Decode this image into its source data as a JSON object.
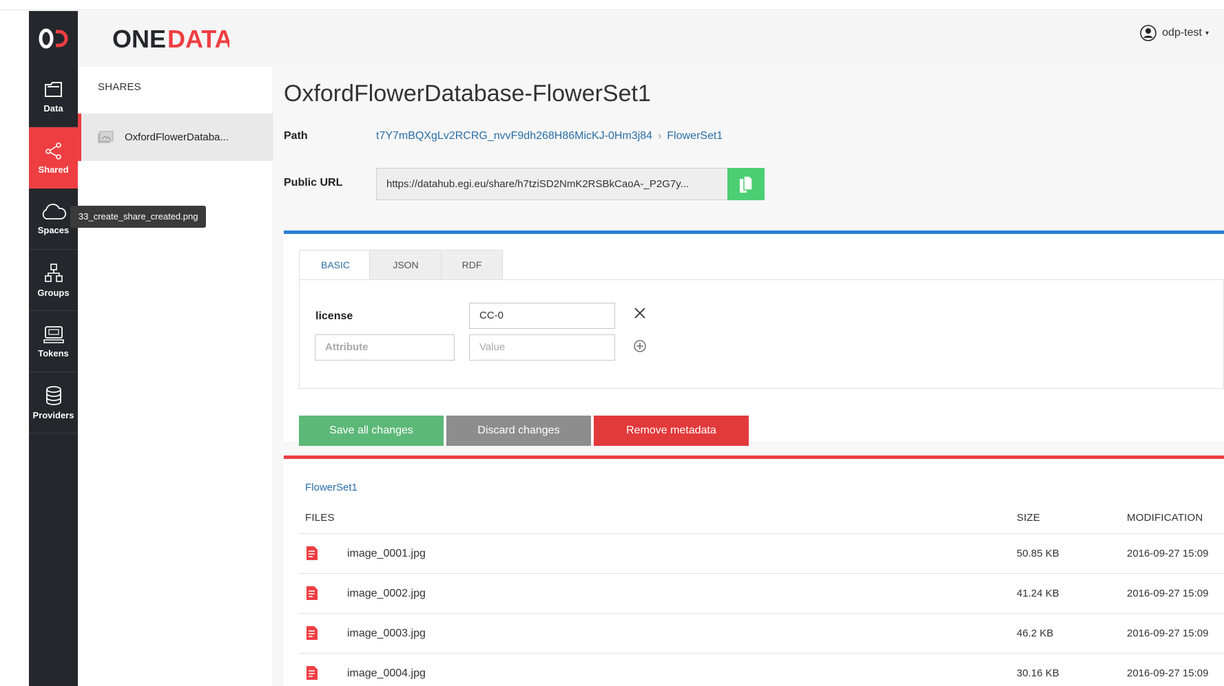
{
  "brand": {
    "logo_mark": "OD",
    "logo_text_left": "ONE",
    "logo_text_right": "DATA",
    "accent_color": "#ef3e42"
  },
  "user": {
    "name": "odp-test",
    "icon": "user-circle-icon"
  },
  "sidebar": {
    "items": [
      {
        "label": "Data",
        "icon": "folder-icon",
        "active": false
      },
      {
        "label": "Shared",
        "icon": "share-icon",
        "active": true
      },
      {
        "label": "Spaces",
        "icon": "cloud-icon",
        "active": false
      },
      {
        "label": "Groups",
        "icon": "groups-icon",
        "active": false
      },
      {
        "label": "Tokens",
        "icon": "token-icon",
        "active": false
      },
      {
        "label": "Providers",
        "icon": "database-icon",
        "active": false
      }
    ]
  },
  "tooltip": {
    "text": "33_create_share_created.png"
  },
  "shares": {
    "title": "SHARES",
    "items": [
      {
        "label": "OxfordFlowerDataba...",
        "icon": "share-image-icon"
      }
    ]
  },
  "share": {
    "title": "OxfordFlowerDatabase-FlowerSet1",
    "path_label": "Path",
    "path_root": "t7Y7mBQXgLv2RCRG_nvvF9dh268H86MicKJ-0Hm3j84",
    "path_leaf": "FlowerSet1",
    "public_url_label": "Public URL",
    "public_url": "https://datahub.egi.eu/share/h7tziSD2NmK2RSBkCaoA-_P2G7y..."
  },
  "metadata": {
    "tabs": [
      {
        "label": "BASIC",
        "active": true
      },
      {
        "label": "JSON",
        "active": false
      },
      {
        "label": "RDF",
        "active": false
      }
    ],
    "entries": [
      {
        "key": "license",
        "value": "CC-0"
      }
    ],
    "new_attribute_placeholder": "Attribute",
    "new_value_placeholder": "Value",
    "buttons": {
      "save": "Save all changes",
      "discard": "Discard changes",
      "remove": "Remove metadata"
    }
  },
  "files": {
    "breadcrumb": "FlowerSet1",
    "columns": {
      "name": "FILES",
      "size": "SIZE",
      "modification": "MODIFICATION"
    },
    "rows": [
      {
        "name": "image_0001.jpg",
        "size": "50.85 KB",
        "modified": "2016-09-27 15:09"
      },
      {
        "name": "image_0002.jpg",
        "size": "41.24 KB",
        "modified": "2016-09-27 15:09"
      },
      {
        "name": "image_0003.jpg",
        "size": "46.2 KB",
        "modified": "2016-09-27 15:09"
      },
      {
        "name": "image_0004.jpg",
        "size": "30.16 KB",
        "modified": "2016-09-27 15:09"
      }
    ]
  }
}
